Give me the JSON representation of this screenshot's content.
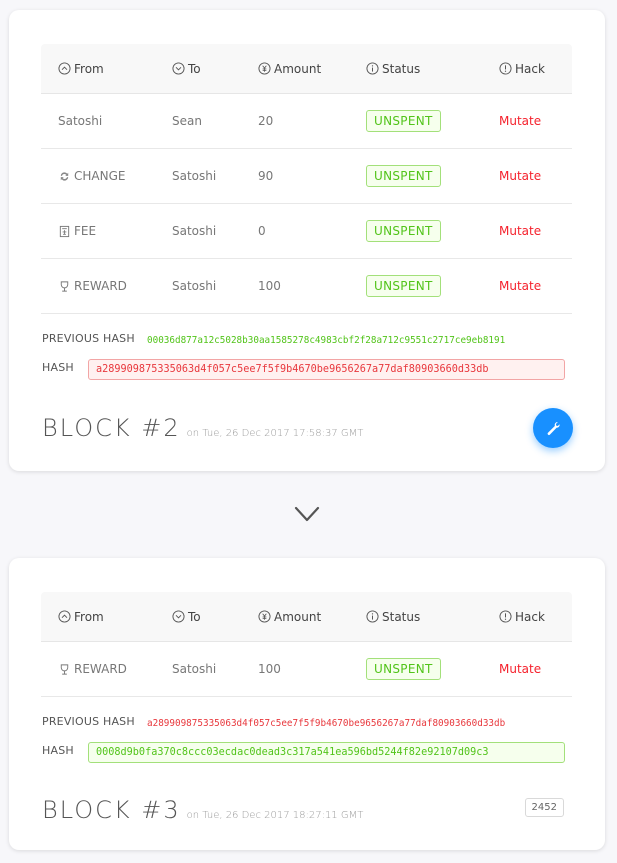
{
  "table_headers": {
    "from": "From",
    "to": "To",
    "amount": "Amount",
    "status": "Status",
    "hack": "Hack"
  },
  "header_icons": {
    "from": "circle-up-icon",
    "to": "circle-down-icon",
    "amount": "currency-circle-icon",
    "status": "info-circle-icon",
    "hack": "exclamation-circle-icon"
  },
  "colors": {
    "accent": "#1890ff",
    "success": "#52c41a",
    "danger": "#f5222d",
    "background": "#f7f7fa"
  },
  "blocks": [
    {
      "title": "BLOCK #2",
      "date": "on Tue, 26 Dec 2017 17:58:37 GMT",
      "transactions": [
        {
          "from": "Satoshi",
          "from_icon": "",
          "to": "Sean",
          "amount": "20",
          "status": "UNSPENT",
          "hack": "Mutate"
        },
        {
          "from": "CHANGE",
          "from_icon": "swap-icon",
          "to": "Satoshi",
          "amount": "90",
          "status": "UNSPENT",
          "hack": "Mutate"
        },
        {
          "from": "FEE",
          "from_icon": "calculator-icon",
          "to": "Satoshi",
          "amount": "0",
          "status": "UNSPENT",
          "hack": "Mutate"
        },
        {
          "from": "REWARD",
          "from_icon": "trophy-icon",
          "to": "Satoshi",
          "amount": "100",
          "status": "UNSPENT",
          "hack": "Mutate"
        }
      ],
      "previous_hash_label": "PREVIOUS HASH",
      "previous_hash": "00036d877a12c5028b30aa1585278c4983cbf2f28a712c9551c2717ce9eb8191",
      "previous_hash_valid": true,
      "hash_label": "HASH",
      "hash": "a289909875335063d4f057c5ee7f5f9b4670be9656267a77daf80903660d33db",
      "hash_valid": false,
      "action": "mine-button",
      "action_icon": "tool-icon"
    },
    {
      "title": "BLOCK #3",
      "date": "on Tue, 26 Dec 2017 18:27:11 GMT",
      "transactions": [
        {
          "from": "REWARD",
          "from_icon": "trophy-icon",
          "to": "Satoshi",
          "amount": "100",
          "status": "UNSPENT",
          "hack": "Mutate"
        }
      ],
      "previous_hash_label": "PREVIOUS HASH",
      "previous_hash": "a289909875335063d4f057c5ee7f5f9b4670be9656267a77daf80903660d33db",
      "previous_hash_valid": false,
      "hash_label": "HASH",
      "hash": "0008d9b0fa370c8ccc03ecdac0dead3c317a541ea596bd5244f82e92107d09c3",
      "hash_valid": true,
      "nonce": "2452"
    }
  ],
  "separator_icon": "chevron-down-icon"
}
